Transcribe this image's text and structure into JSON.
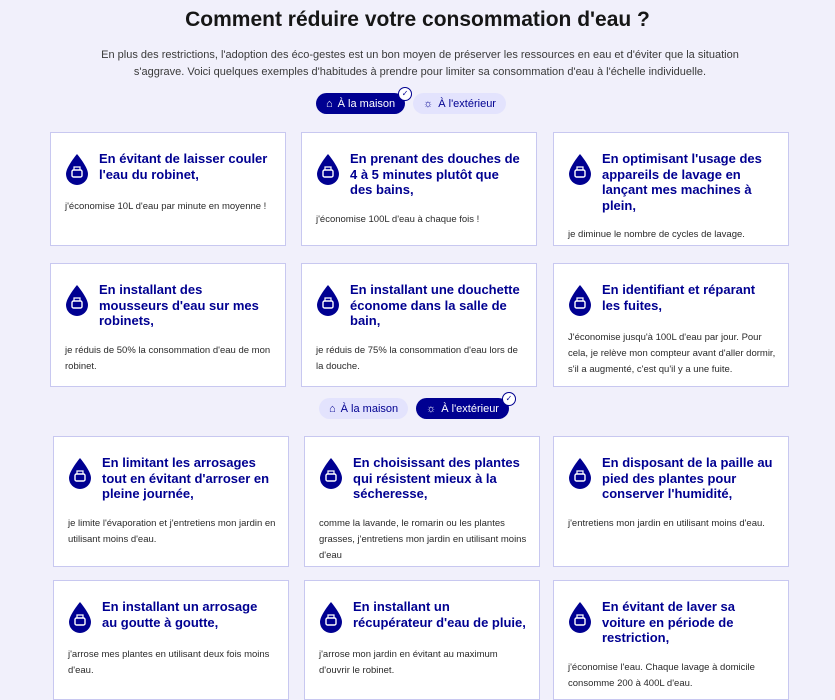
{
  "page": {
    "title": "Comment réduire votre consommation d'eau ?",
    "intro": "En plus des restrictions, l'adoption des éco-gestes est un bon moyen de préserver les ressources en eau et d'éviter que la situation s'aggrave. Voici quelques exemples d'habitudes à prendre pour limiter sa consommation d'eau à l'échelle individuelle."
  },
  "colors": {
    "accent": "#000091",
    "accent_light": "#e3e3fd",
    "background": "#f1f0fb"
  },
  "section_home": {
    "toggle": {
      "home_label": "À la maison",
      "outside_label": "À l'extérieur",
      "selected": "home"
    },
    "cards": [
      {
        "icon": "faucet-drop-icon",
        "title": "En évitant de laisser couler l'eau du robinet,",
        "text": "j'économise 10L d'eau par minute en moyenne !"
      },
      {
        "icon": "shower-drop-icon",
        "title": "En prenant des douches de 4 à 5 minutes plutôt que des bains,",
        "text": "j'économise 100L d'eau à chaque fois !"
      },
      {
        "icon": "washing-machine-drop-icon",
        "title": "En optimisant l'usage des appareils de lavage en lançant mes machines à plein,",
        "text": "je diminue le nombre de cycles de lavage."
      },
      {
        "icon": "aerator-drop-icon",
        "title": "En installant des mousseurs d'eau sur mes robinets,",
        "text": "je réduis de 50% la consommation d'eau de mon robinet."
      },
      {
        "icon": "shower-head-drop-icon",
        "title": "En installant une douchette économe dans la salle de bain,",
        "text": "je réduis de 75% la consommation d'eau lors de la douche."
      },
      {
        "icon": "leak-drop-icon",
        "title": "En identifiant et réparant les fuites,",
        "text": "J'économise jusqu'à 100L d'eau par jour. Pour cela, je relève mon compteur avant d'aller dormir, s'il a augmenté, c'est qu'il y a une fuite."
      }
    ]
  },
  "section_outside": {
    "toggle": {
      "home_label": "À la maison",
      "outside_label": "À l'extérieur",
      "selected": "outside"
    },
    "cards": [
      {
        "icon": "watering-can-drop-icon",
        "title": "En limitant les arrosages tout en évitant d'arroser en pleine journée,",
        "text": "je limite l'évaporation et j'entretiens mon jardin en utilisant moins d'eau."
      },
      {
        "icon": "plant-drop-icon",
        "title": "En choisissant des plantes qui résistent mieux à la sécheresse,",
        "text": "comme la lavande, le romarin ou les plantes grasses, j'entretiens mon jardin en utilisant moins d'eau"
      },
      {
        "icon": "straw-drop-icon",
        "title": "En disposant de la paille au pied des plantes pour conserver l'humidité,",
        "text": "j'entretiens mon jardin en utilisant moins d'eau."
      },
      {
        "icon": "drip-irrigation-drop-icon",
        "title": "En installant un arrosage au goutte à goutte,",
        "text": "j'arrose mes plantes en utilisant deux fois moins d'eau."
      },
      {
        "icon": "rain-collector-drop-icon",
        "title": "En installant un récupérateur d'eau de pluie,",
        "text": "j'arrose mon jardin en évitant au maximum d'ouvrir le robinet."
      },
      {
        "icon": "car-drop-icon",
        "title": "En évitant de laver sa voiture en période de restriction,",
        "text": "j'économise l'eau. Chaque lavage à domicile consomme 200 à 400L d'eau."
      }
    ]
  }
}
